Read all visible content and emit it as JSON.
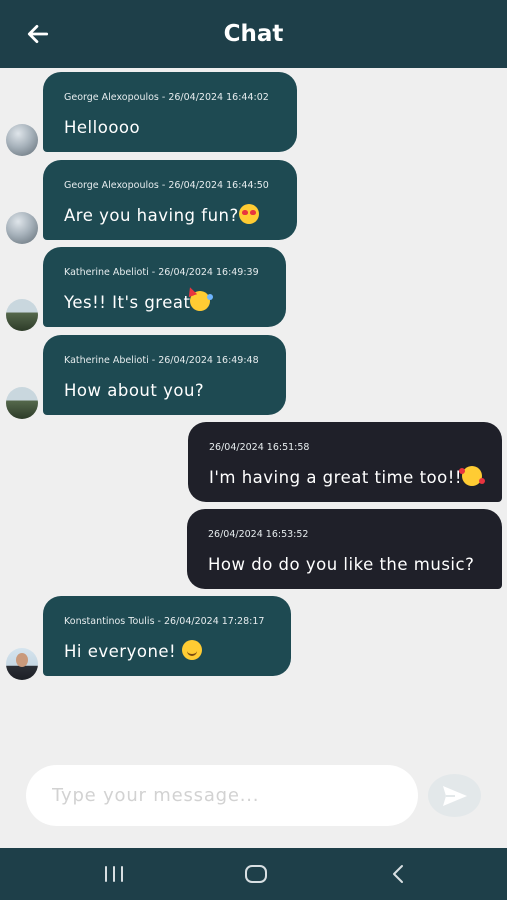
{
  "header": {
    "title": "Chat",
    "back_icon": "arrow-left-icon"
  },
  "messages": [
    {
      "direction": "incoming",
      "avatar": "avatar-george",
      "meta": "George Alexopoulos - 26/04/2024 16:44:02",
      "text": "Helloooo",
      "emoji": ""
    },
    {
      "direction": "incoming",
      "avatar": "avatar-george",
      "meta": "George Alexopoulos - 26/04/2024 16:44:50",
      "text": "Are you having fun?",
      "emoji": "smiling-face-with-heart-eyes"
    },
    {
      "direction": "incoming",
      "avatar": "avatar-katherine",
      "meta": "Katherine Abelioti - 26/04/2024 16:49:39",
      "text": "Yes!! It's great",
      "emoji": "partying-face"
    },
    {
      "direction": "incoming",
      "avatar": "avatar-katherine",
      "meta": "Katherine Abelioti - 26/04/2024 16:49:48",
      "text": "How about you?",
      "emoji": ""
    },
    {
      "direction": "outgoing",
      "meta": "26/04/2024 16:51:58",
      "text": "I'm having a great time too!!",
      "emoji": "smiling-face-with-hearts"
    },
    {
      "direction": "outgoing",
      "meta": "26/04/2024 16:53:52",
      "text": "How do do you like the music?",
      "emoji": ""
    },
    {
      "direction": "incoming",
      "avatar": "avatar-konstantinos",
      "meta": "Konstantinos Toulis - 26/04/2024 17:28:17",
      "text": "Hi everyone! ",
      "emoji": "smiling-face"
    }
  ],
  "composer": {
    "placeholder": "Type your message...",
    "value": "",
    "send_icon": "send-icon"
  },
  "system_nav": {
    "recents_icon": "recents-icon",
    "home_icon": "home-icon",
    "back_icon": "chevron-left-icon"
  },
  "colors": {
    "header": "#1e3f49",
    "incoming_bubble": "#1e4a52",
    "outgoing_bubble": "#1f2029",
    "background": "#efefef"
  }
}
